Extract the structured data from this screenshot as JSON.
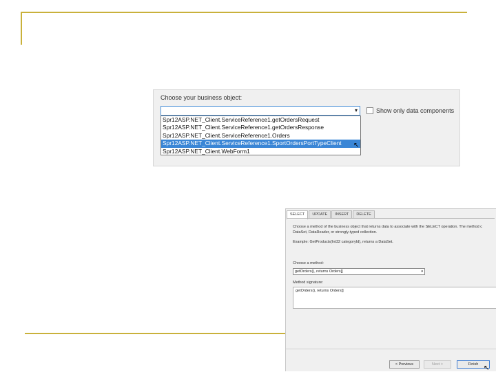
{
  "dialog1": {
    "choose_label": "Choose your business object:",
    "selected_value": "",
    "checkbox_label": "Show only data components",
    "items": [
      "Spr12ASP.NET_Client.ServiceReference1.getOrdersRequest",
      "Spr12ASP.NET_Client.ServiceReference1.getOrdersResponse",
      "Spr12ASP.NET_Client.ServiceReference1.Orders",
      "Spr12ASP.NET_Client.ServiceReference1.SportOrdersPortTypeClient",
      "Spr12ASP.NET_Client.WebForm1"
    ],
    "selected_index": 3
  },
  "dialog2": {
    "tabs": [
      "SELECT",
      "UPDATE",
      "INSERT",
      "DELETE"
    ],
    "active_tab": "SELECT",
    "description_line1": "Choose a method of the business object that returns data to associate with the SELECT operation. The method c",
    "description_line2": "DataSet, DataReader, or strongly-typed collection.",
    "example_text": "Example: GetProducts(Int32 categoryId), returns a DataSet.",
    "choose_method_label": "Choose a method:",
    "method_value": "getOrders(), returns Orders[]",
    "signature_label": "Method signature:",
    "signature_value": "getOrders(), returns Orders[]",
    "buttons": {
      "previous": "< Previous",
      "next": "Next >",
      "finish": "Finish"
    }
  },
  "colors": {
    "accent_line": "#c9b13b",
    "selection": "#3a86d6"
  }
}
